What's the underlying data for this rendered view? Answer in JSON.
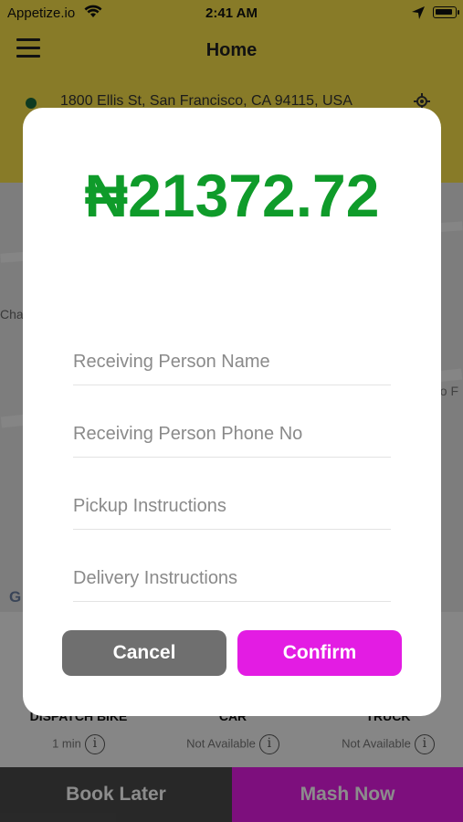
{
  "status_bar": {
    "carrier": "Appetize.io",
    "time": "2:41 AM"
  },
  "header": {
    "title": "Home",
    "address": "1800 Ellis St, San Francisco, CA 94115, USA"
  },
  "map": {
    "label_left": "Cha",
    "label_right": "no F",
    "attribution": "G"
  },
  "vehicles": [
    {
      "name": "DISPATCH BIKE",
      "eta": "1 min"
    },
    {
      "name": "CAR",
      "eta": "Not Available"
    },
    {
      "name": "TRUCK",
      "eta": "Not Available"
    }
  ],
  "bottom_bar": {
    "book_later": "Book Later",
    "mash_now": "Mash Now"
  },
  "dialog": {
    "amount": "₦21372.72",
    "fields": {
      "receiver_name": {
        "placeholder": "Receiving Person Name"
      },
      "receiver_phone": {
        "placeholder": "Receiving Person Phone No"
      },
      "pickup": {
        "placeholder": "Pickup Instructions"
      },
      "delivery": {
        "placeholder": "Delivery Instructions"
      }
    },
    "cancel": "Cancel",
    "confirm": "Confirm"
  },
  "colors": {
    "header": "#f7e14a",
    "amount": "#0f9b2a",
    "accent": "#e31ce3",
    "cancel": "#6f6f6f"
  }
}
